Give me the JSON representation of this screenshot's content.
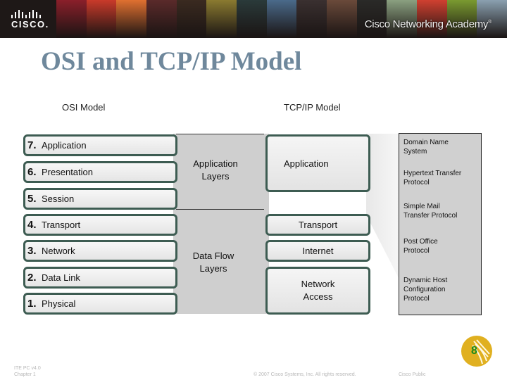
{
  "banner": {
    "logo_text": "CISCO.",
    "academy_text": "Cisco Networking Academy",
    "trademark": "®",
    "photo_colors": [
      "#8a1f2a",
      "#c93a2a",
      "#e07030",
      "#5a2a2a",
      "#3a2a20",
      "#8a7a30",
      "#2a3a3a",
      "#4a6a8a",
      "#3a3030",
      "#6a4a3a",
      "#2a2a28",
      "#8aa080",
      "#d04030",
      "#7a9a30",
      "#8aa0b0"
    ]
  },
  "slide": {
    "title": "OSI and TCP/IP Model"
  },
  "osi": {
    "heading": "OSI Model",
    "layers": [
      {
        "num": "7.",
        "name": "Application"
      },
      {
        "num": "6.",
        "name": "Presentation"
      },
      {
        "num": "5.",
        "name": "Session"
      },
      {
        "num": "4.",
        "name": "Transport"
      },
      {
        "num": "3.",
        "name": "Network"
      },
      {
        "num": "2.",
        "name": "Data Link"
      },
      {
        "num": "1.",
        "name": "Physical"
      }
    ]
  },
  "groups": {
    "upper": "Application Layers",
    "lower": "Data Flow Layers"
  },
  "tcpip": {
    "heading": "TCP/IP Model",
    "layers": [
      {
        "name": "Application"
      },
      {
        "name": "Transport"
      },
      {
        "name": "Internet"
      },
      {
        "name": "Network Access"
      }
    ]
  },
  "protocols": [
    "Domain Name System",
    "Hypertext Transfer Protocol",
    "Simple Mail Transfer Protocol",
    "Post Office Protocol",
    "Dynamic Host Configuration Protocol"
  ],
  "footer": {
    "course": "ITE PC v4.0",
    "chapter": "Chapter 1",
    "copyright": "© 2007 Cisco Systems, Inc. All rights reserved.",
    "classification": "Cisco Public",
    "page_number": "8"
  },
  "colors": {
    "title": "#6f889c",
    "layer_border": "#3d5c52",
    "band_gray": "#cfcfcf",
    "badge": "#e0b020",
    "page_number": "#1a8a1a"
  }
}
